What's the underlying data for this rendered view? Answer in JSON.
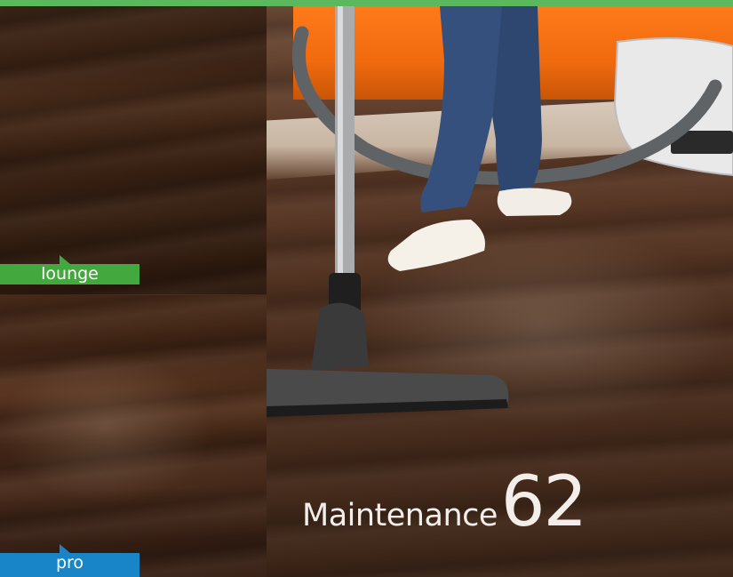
{
  "tags": {
    "lounge": "lounge",
    "pro": "pro"
  },
  "caption": {
    "title": "Maintenance",
    "page_number": "62"
  },
  "colors": {
    "top_bar": "#5cb85c",
    "lounge_tag": "#43a83d",
    "pro_tag": "#1985c9",
    "caption_text": "#f3eee9"
  }
}
